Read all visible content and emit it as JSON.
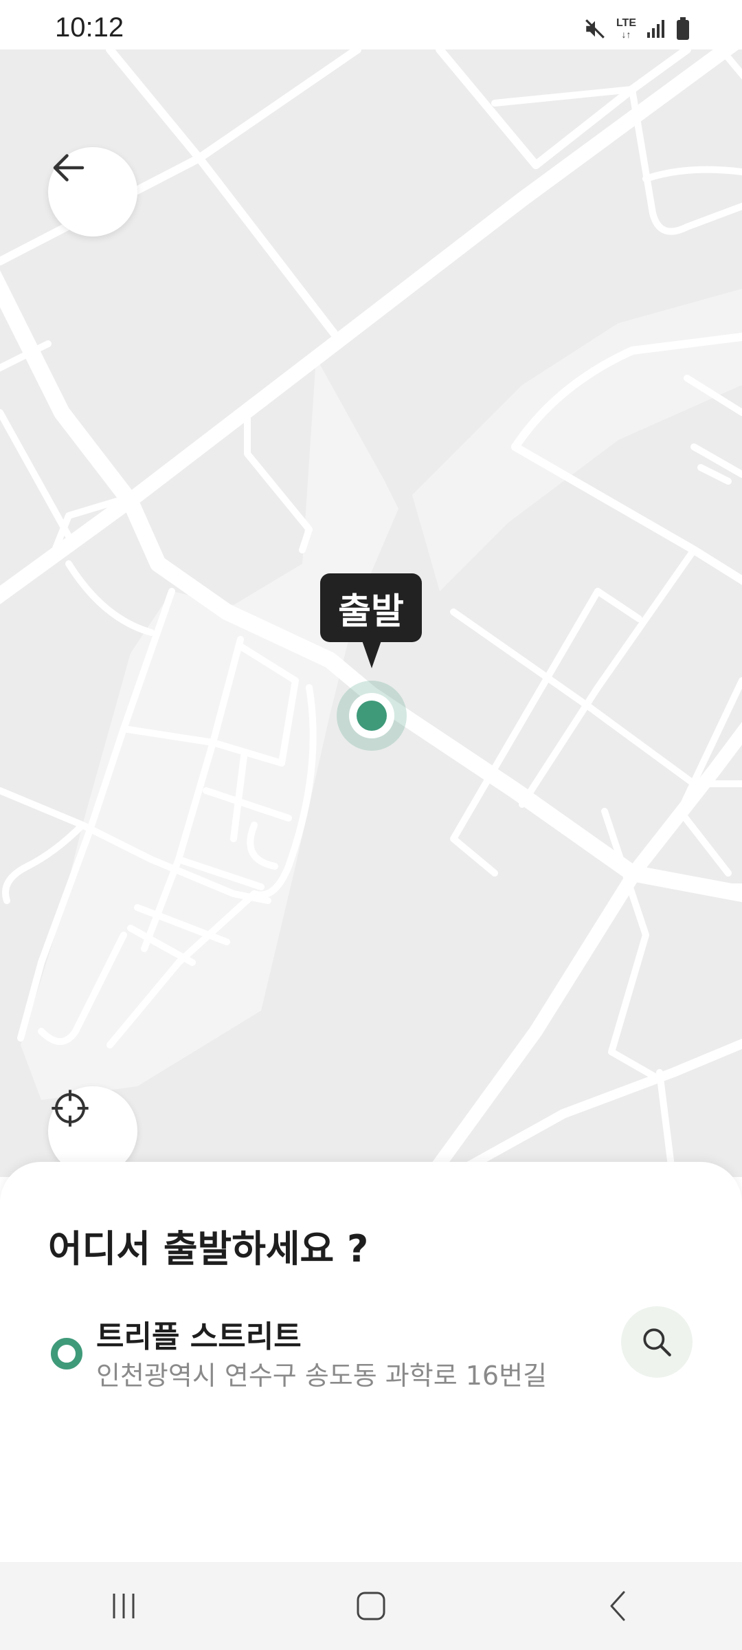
{
  "status_bar": {
    "time": "10:12",
    "network": "LTE",
    "icons": [
      "mute-icon",
      "lte-icon",
      "signal-icon",
      "battery-icon"
    ]
  },
  "map": {
    "start_marker_label": "출발",
    "icons": [
      "back-arrow-icon",
      "crosshair-icon",
      "location-pin-icon"
    ]
  },
  "sheet": {
    "title": "어디서 출발하세요 ?",
    "location": {
      "name": "트리플 스트리트",
      "address": "인천광역시 연수구 송도동 과학로 16번길"
    },
    "icons": [
      "location-dot-icon",
      "search-icon"
    ]
  },
  "nav_bar": {
    "icons": [
      "recent-apps-icon",
      "home-icon",
      "back-icon"
    ]
  },
  "colors": {
    "accent": "#3f9a7a",
    "map_background": "#ececec",
    "road": "#ffffff",
    "tooltip": "#222222"
  }
}
